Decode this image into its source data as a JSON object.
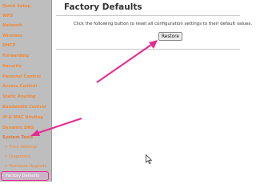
{
  "sidebar": {
    "items": [
      {
        "label": "Quick Setup",
        "type": "main"
      },
      {
        "label": "WPS",
        "type": "main"
      },
      {
        "label": "Network",
        "type": "main"
      },
      {
        "label": "Wireless",
        "type": "main"
      },
      {
        "label": "DHCP",
        "type": "main"
      },
      {
        "label": "Forwarding",
        "type": "main"
      },
      {
        "label": "Security",
        "type": "main"
      },
      {
        "label": "Parental Control",
        "type": "main"
      },
      {
        "label": "Access Control",
        "type": "main"
      },
      {
        "label": "Static Routing",
        "type": "main"
      },
      {
        "label": "Bandwidth Control",
        "type": "main"
      },
      {
        "label": "IP & MAC Binding",
        "type": "main"
      },
      {
        "label": "Dynamic DNS",
        "type": "main"
      },
      {
        "label": "System Tools",
        "type": "main"
      },
      {
        "label": "Time Settings",
        "type": "sub"
      },
      {
        "label": "Diagnostic",
        "type": "sub"
      },
      {
        "label": "Firmware Upgrade",
        "type": "sub"
      },
      {
        "label": "Factory Defaults",
        "type": "sub"
      }
    ]
  },
  "main": {
    "title": "Factory Defaults",
    "instruction": "Click the following button to reset all configuration settings to their default values.",
    "restore_label": "Restore"
  },
  "colors": {
    "sidebar_bg": "#bebebe",
    "sidebar_text": "#ee8a3a",
    "annotation_arrow": "#e82a8f"
  }
}
